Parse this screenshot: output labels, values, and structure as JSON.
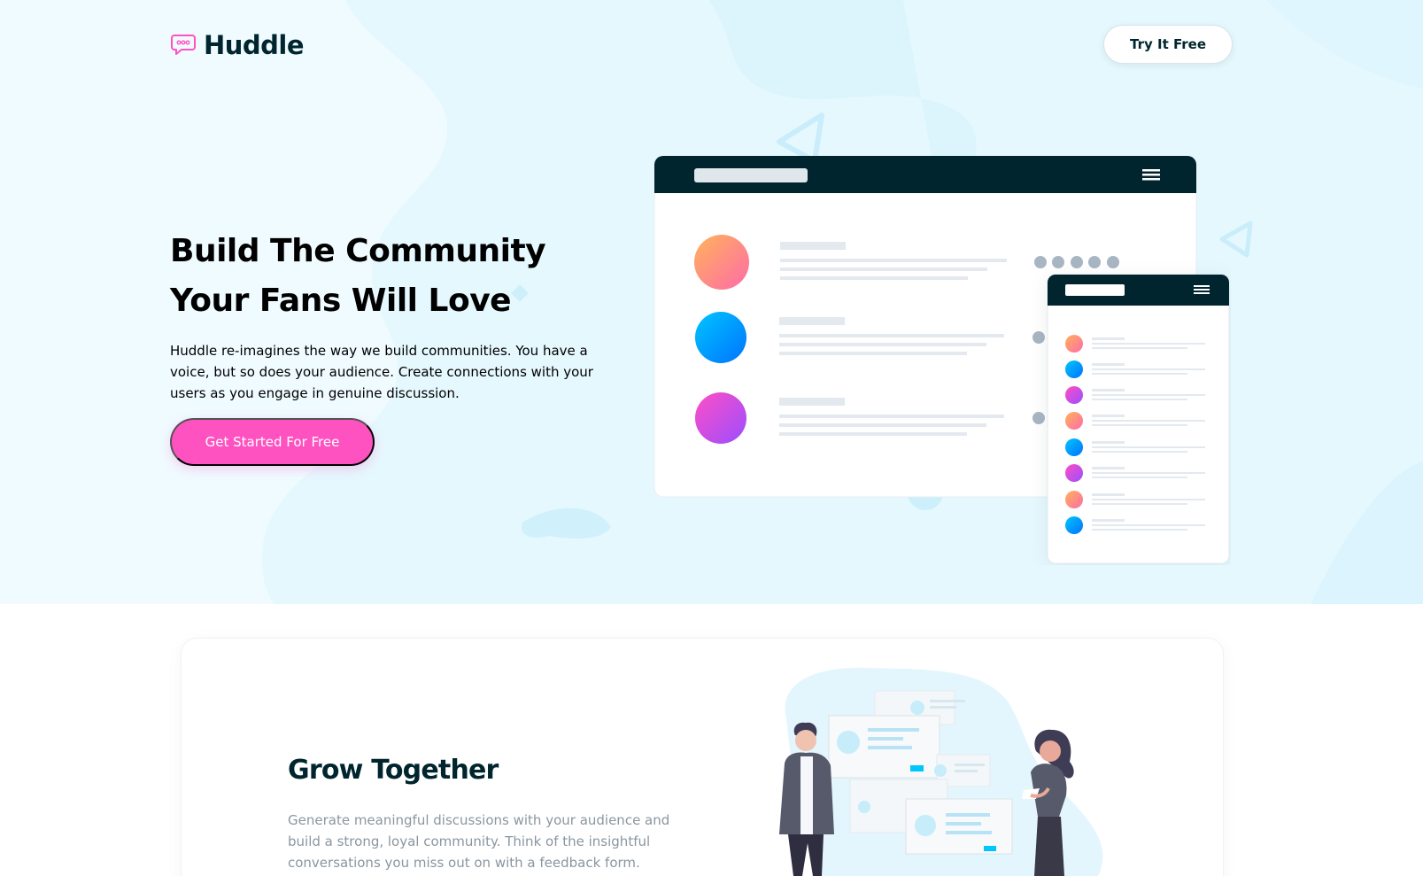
{
  "header": {
    "logo_text": "Huddle",
    "logo_icon": "chat-bubble-icon",
    "try_button_label": "Try It Free"
  },
  "hero": {
    "headline_line1": "Build The Community",
    "headline_line2": "Your Fans Will Love",
    "lede": "Huddle re-imagines the way we build communities. You have a voice, but so does your audience. Create connections with your users as you engage in genuine discussion.",
    "cta_label": "Get Started For Free"
  },
  "feature": {
    "title": "Grow Together",
    "text": "Generate meaningful discussions with your audience and build a strong, loyal community. Think of the insightful conversations you miss out on with a feedback form."
  },
  "colors": {
    "dark_cyan": "#00252e",
    "pink": "#ff52c1",
    "hero_bg": "#e9f9ff",
    "muted_text": "#8a96a0"
  }
}
